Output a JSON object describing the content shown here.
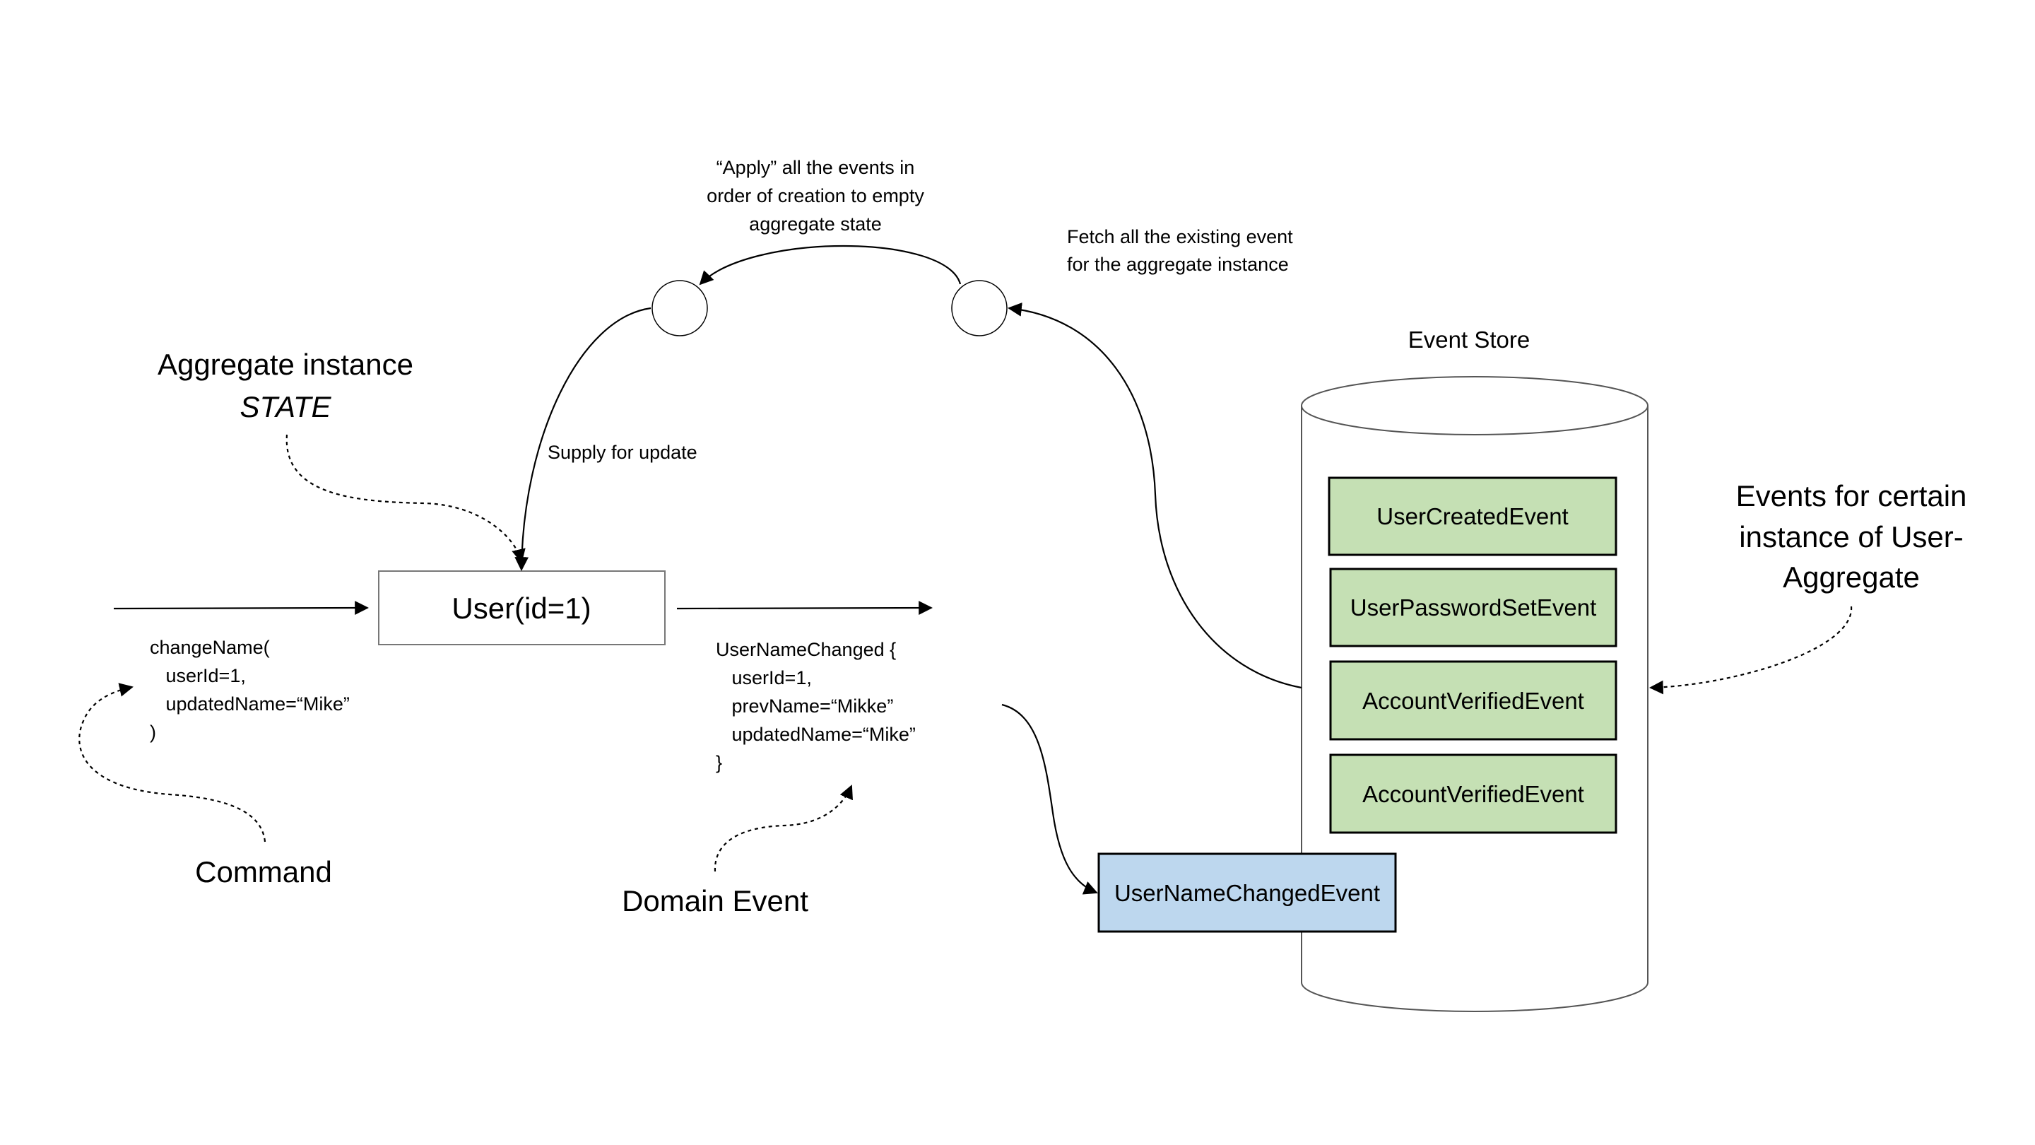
{
  "labels": {
    "aggregate_line1": "Aggregate instance",
    "aggregate_line2": "STATE",
    "command": "Command",
    "domain_event": "Domain Event",
    "event_store": "Event Store",
    "events_note": [
      "Events for certain",
      "instance of User-",
      "Aggregate"
    ],
    "apply_note": [
      "“Apply” all the events in",
      "order of creation to empty",
      "aggregate state"
    ],
    "fetch_note": [
      "Fetch all the existing event",
      "for the aggregate instance"
    ],
    "supply": "Supply for update"
  },
  "aggregate_box": "User(id=1)",
  "command_code": [
    "changeName(",
    "   userId=1,",
    "   updatedName=“Mike”",
    ")"
  ],
  "event_code": [
    "UserNameChanged {",
    "   userId=1,",
    "   prevName=“Mikke”",
    "   updatedName=“Mike”",
    "}"
  ],
  "stored_events": [
    "UserCreatedEvent",
    "UserPasswordSetEvent",
    "AccountVerifiedEvent",
    "AccountVerifiedEvent"
  ],
  "new_event": "UserNameChangedEvent",
  "colors": {
    "stored_event_fill": "#c5e0b4",
    "new_event_fill": "#bdd7ee"
  }
}
